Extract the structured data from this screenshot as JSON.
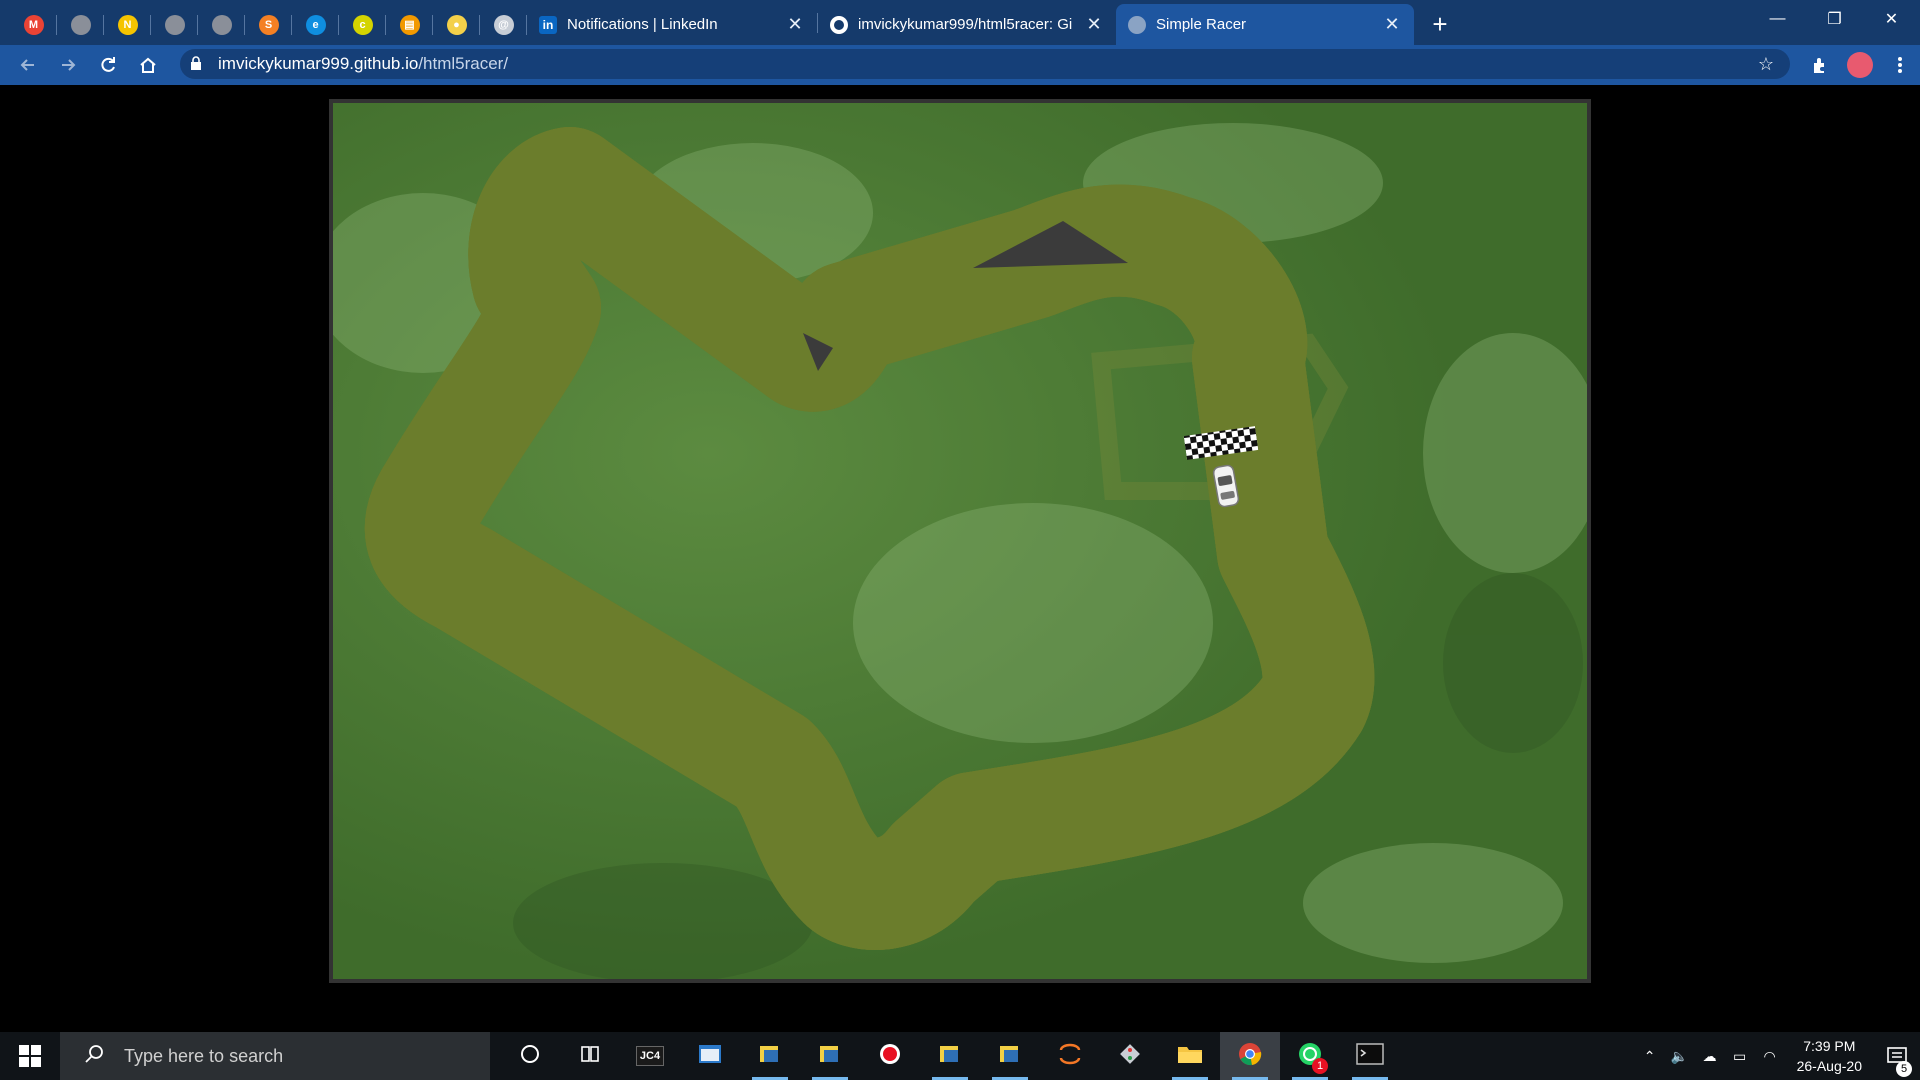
{
  "browser": {
    "pinned_tabs": [
      {
        "icon": "gmail-icon",
        "color": "#ea4335",
        "glyph": "M"
      },
      {
        "icon": "globe-icon",
        "color": "#8a8f99",
        "glyph": ""
      },
      {
        "icon": "norton-icon",
        "color": "#f5c400",
        "glyph": "N"
      },
      {
        "icon": "globe-icon",
        "color": "#8a8f99",
        "glyph": ""
      },
      {
        "icon": "globe-icon",
        "color": "#8a8f99",
        "glyph": ""
      },
      {
        "icon": "stackoverflow-icon",
        "color": "#f48024",
        "glyph": "S"
      },
      {
        "icon": "edge-icon",
        "color": "#0f8ee0",
        "glyph": "e"
      },
      {
        "icon": "codechef-icon",
        "color": "#d4d400",
        "glyph": "c"
      },
      {
        "icon": "notes-icon",
        "color": "#f29900",
        "glyph": "▤"
      },
      {
        "icon": "cookie-icon",
        "color": "#f3d04a",
        "glyph": "●"
      },
      {
        "icon": "spiral-icon",
        "color": "#c7cdd6",
        "glyph": "@"
      }
    ],
    "tabs": [
      {
        "title": "Notifications | LinkedIn",
        "icon": "linkedin-icon",
        "close": "✕",
        "active": false
      },
      {
        "title": "imvickykumar999/html5racer: Gi",
        "icon": "github-icon",
        "close": "✕",
        "active": false
      },
      {
        "title": "Simple Racer",
        "icon": "globe-icon",
        "close": "✕",
        "active": true
      }
    ],
    "new_tab": "+",
    "window_controls": {
      "minimize": "—",
      "restore": "❐",
      "close": "✕"
    },
    "url_domain": "imvickykumar999.github.io",
    "url_path": "/html5racer/"
  },
  "game": {
    "title": "Simple Racer",
    "colors": {
      "grass": "#4d7a34",
      "track": "#050505",
      "edge": "#6c7a2a",
      "frame": "#333333"
    }
  },
  "taskbar": {
    "search_placeholder": "Type here to search",
    "apps": [
      {
        "name": "cortana-icon",
        "label": "",
        "running": false
      },
      {
        "name": "task-view-icon",
        "label": "",
        "running": false
      },
      {
        "name": "jc4-icon",
        "label": "JC4",
        "running": false
      },
      {
        "name": "window-app-icon",
        "label": "",
        "running": false
      },
      {
        "name": "python-idle-icon",
        "label": "",
        "running": true
      },
      {
        "name": "python-idle-icon",
        "label": "",
        "running": true
      },
      {
        "name": "record-icon",
        "label": "",
        "running": false
      },
      {
        "name": "python-idle-icon",
        "label": "",
        "running": true
      },
      {
        "name": "python-idle-icon",
        "label": "",
        "running": true
      },
      {
        "name": "jupyter-icon",
        "label": "",
        "running": false
      },
      {
        "name": "git-icon",
        "label": "",
        "running": false
      },
      {
        "name": "file-explorer-icon",
        "label": "",
        "running": true
      },
      {
        "name": "chrome-icon",
        "label": "",
        "running": true,
        "focused": true
      },
      {
        "name": "whatsapp-icon",
        "label": "1",
        "running": true
      },
      {
        "name": "terminal-icon",
        "label": "",
        "running": true
      }
    ],
    "time": "7:39 PM",
    "date": "26-Aug-20",
    "notification_count": "5"
  }
}
